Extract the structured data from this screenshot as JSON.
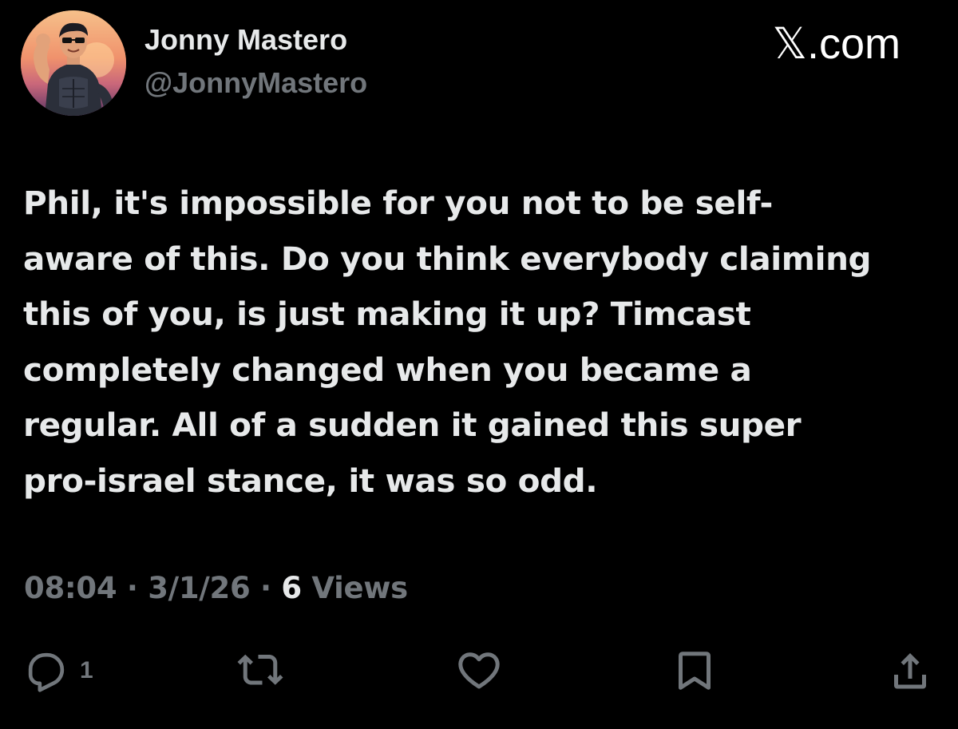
{
  "header": {
    "display_name": "Jonny Mastero",
    "handle": "@JonnyMastero",
    "brand": "𝕏.com"
  },
  "tweet": {
    "lines": [
      "Phil, it's impossible for you not to be self-",
      "aware of this. Do you think everybody claiming",
      "this of you, is just making it up? Timcast",
      "completely changed when you became a",
      "regular. All of a sudden it gained this super",
      "pro-israel stance, it was so odd."
    ]
  },
  "meta": {
    "time": "08:04",
    "date": "3/1/26",
    "separator": " · ",
    "views_count": "6",
    "views_label": " Views"
  },
  "actions": {
    "reply_count": "1",
    "icons": [
      "reply-icon",
      "retweet-icon",
      "like-icon",
      "bookmark-icon",
      "share-icon"
    ]
  },
  "colors": {
    "background": "#000000",
    "primary_text": "#e7e9ea",
    "secondary_text": "#71767b"
  }
}
